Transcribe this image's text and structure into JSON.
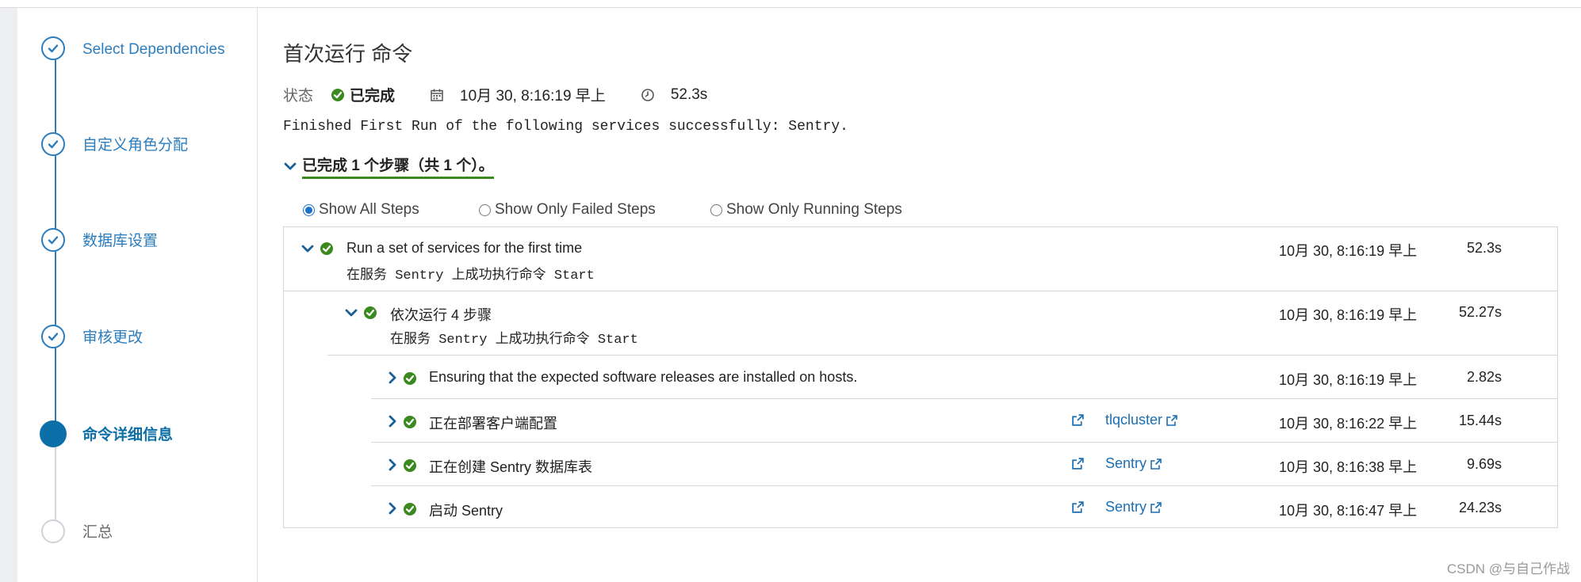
{
  "sidebar": {
    "steps": [
      {
        "label": "Select Dependencies",
        "state": "done"
      },
      {
        "label": "自定义角色分配",
        "state": "done"
      },
      {
        "label": "数据库设置",
        "state": "done"
      },
      {
        "label": "审核更改",
        "state": "done"
      },
      {
        "label": "命令详细信息",
        "state": "active"
      },
      {
        "label": "汇总",
        "state": "pending"
      }
    ]
  },
  "header": {
    "title": "首次运行 命令",
    "status_label": "状态",
    "status_value": "已完成",
    "date": "10月 30, 8:16:19 早上",
    "duration": "52.3s"
  },
  "message": "Finished First Run of the following services successfully: Sentry.",
  "summary": "已完成 1 个步骤（共 1 个）。",
  "filters": [
    {
      "label": "Show All Steps",
      "checked": true
    },
    {
      "label": "Show Only Failed Steps",
      "checked": false
    },
    {
      "label": "Show Only Running Steps",
      "checked": false
    }
  ],
  "rows": [
    {
      "title": "Run a set of services for the first time",
      "subtitle": "在服务 Sentry 上成功执行命令 Start",
      "time": "10月 30, 8:16:19 早上",
      "duration": "52.3s",
      "expanded": true
    },
    {
      "title": "依次运行 4 步骤",
      "subtitle": "在服务 Sentry 上成功执行命令 Start",
      "time": "10月 30, 8:16:19 早上",
      "duration": "52.27s",
      "expanded": true
    },
    {
      "title": "Ensuring that the expected software releases are installed on hosts.",
      "time": "10月 30, 8:16:19 早上",
      "duration": "2.82s",
      "link": ""
    },
    {
      "title": "正在部署客户端配置",
      "time": "10月 30, 8:16:22 早上",
      "duration": "15.44s",
      "link": "tlqcluster"
    },
    {
      "title": "正在创建 Sentry 数据库表",
      "time": "10月 30, 8:16:38 早上",
      "duration": "9.69s",
      "link": "Sentry"
    },
    {
      "title": "启动 Sentry",
      "time": "10月 30, 8:16:47 早上",
      "duration": "24.23s",
      "link": "Sentry"
    }
  ],
  "colors": {
    "accent": "#2b7dbd",
    "success": "#3a8a1f",
    "link": "#1a6fb5"
  },
  "watermark": "CSDN @与自己作战"
}
